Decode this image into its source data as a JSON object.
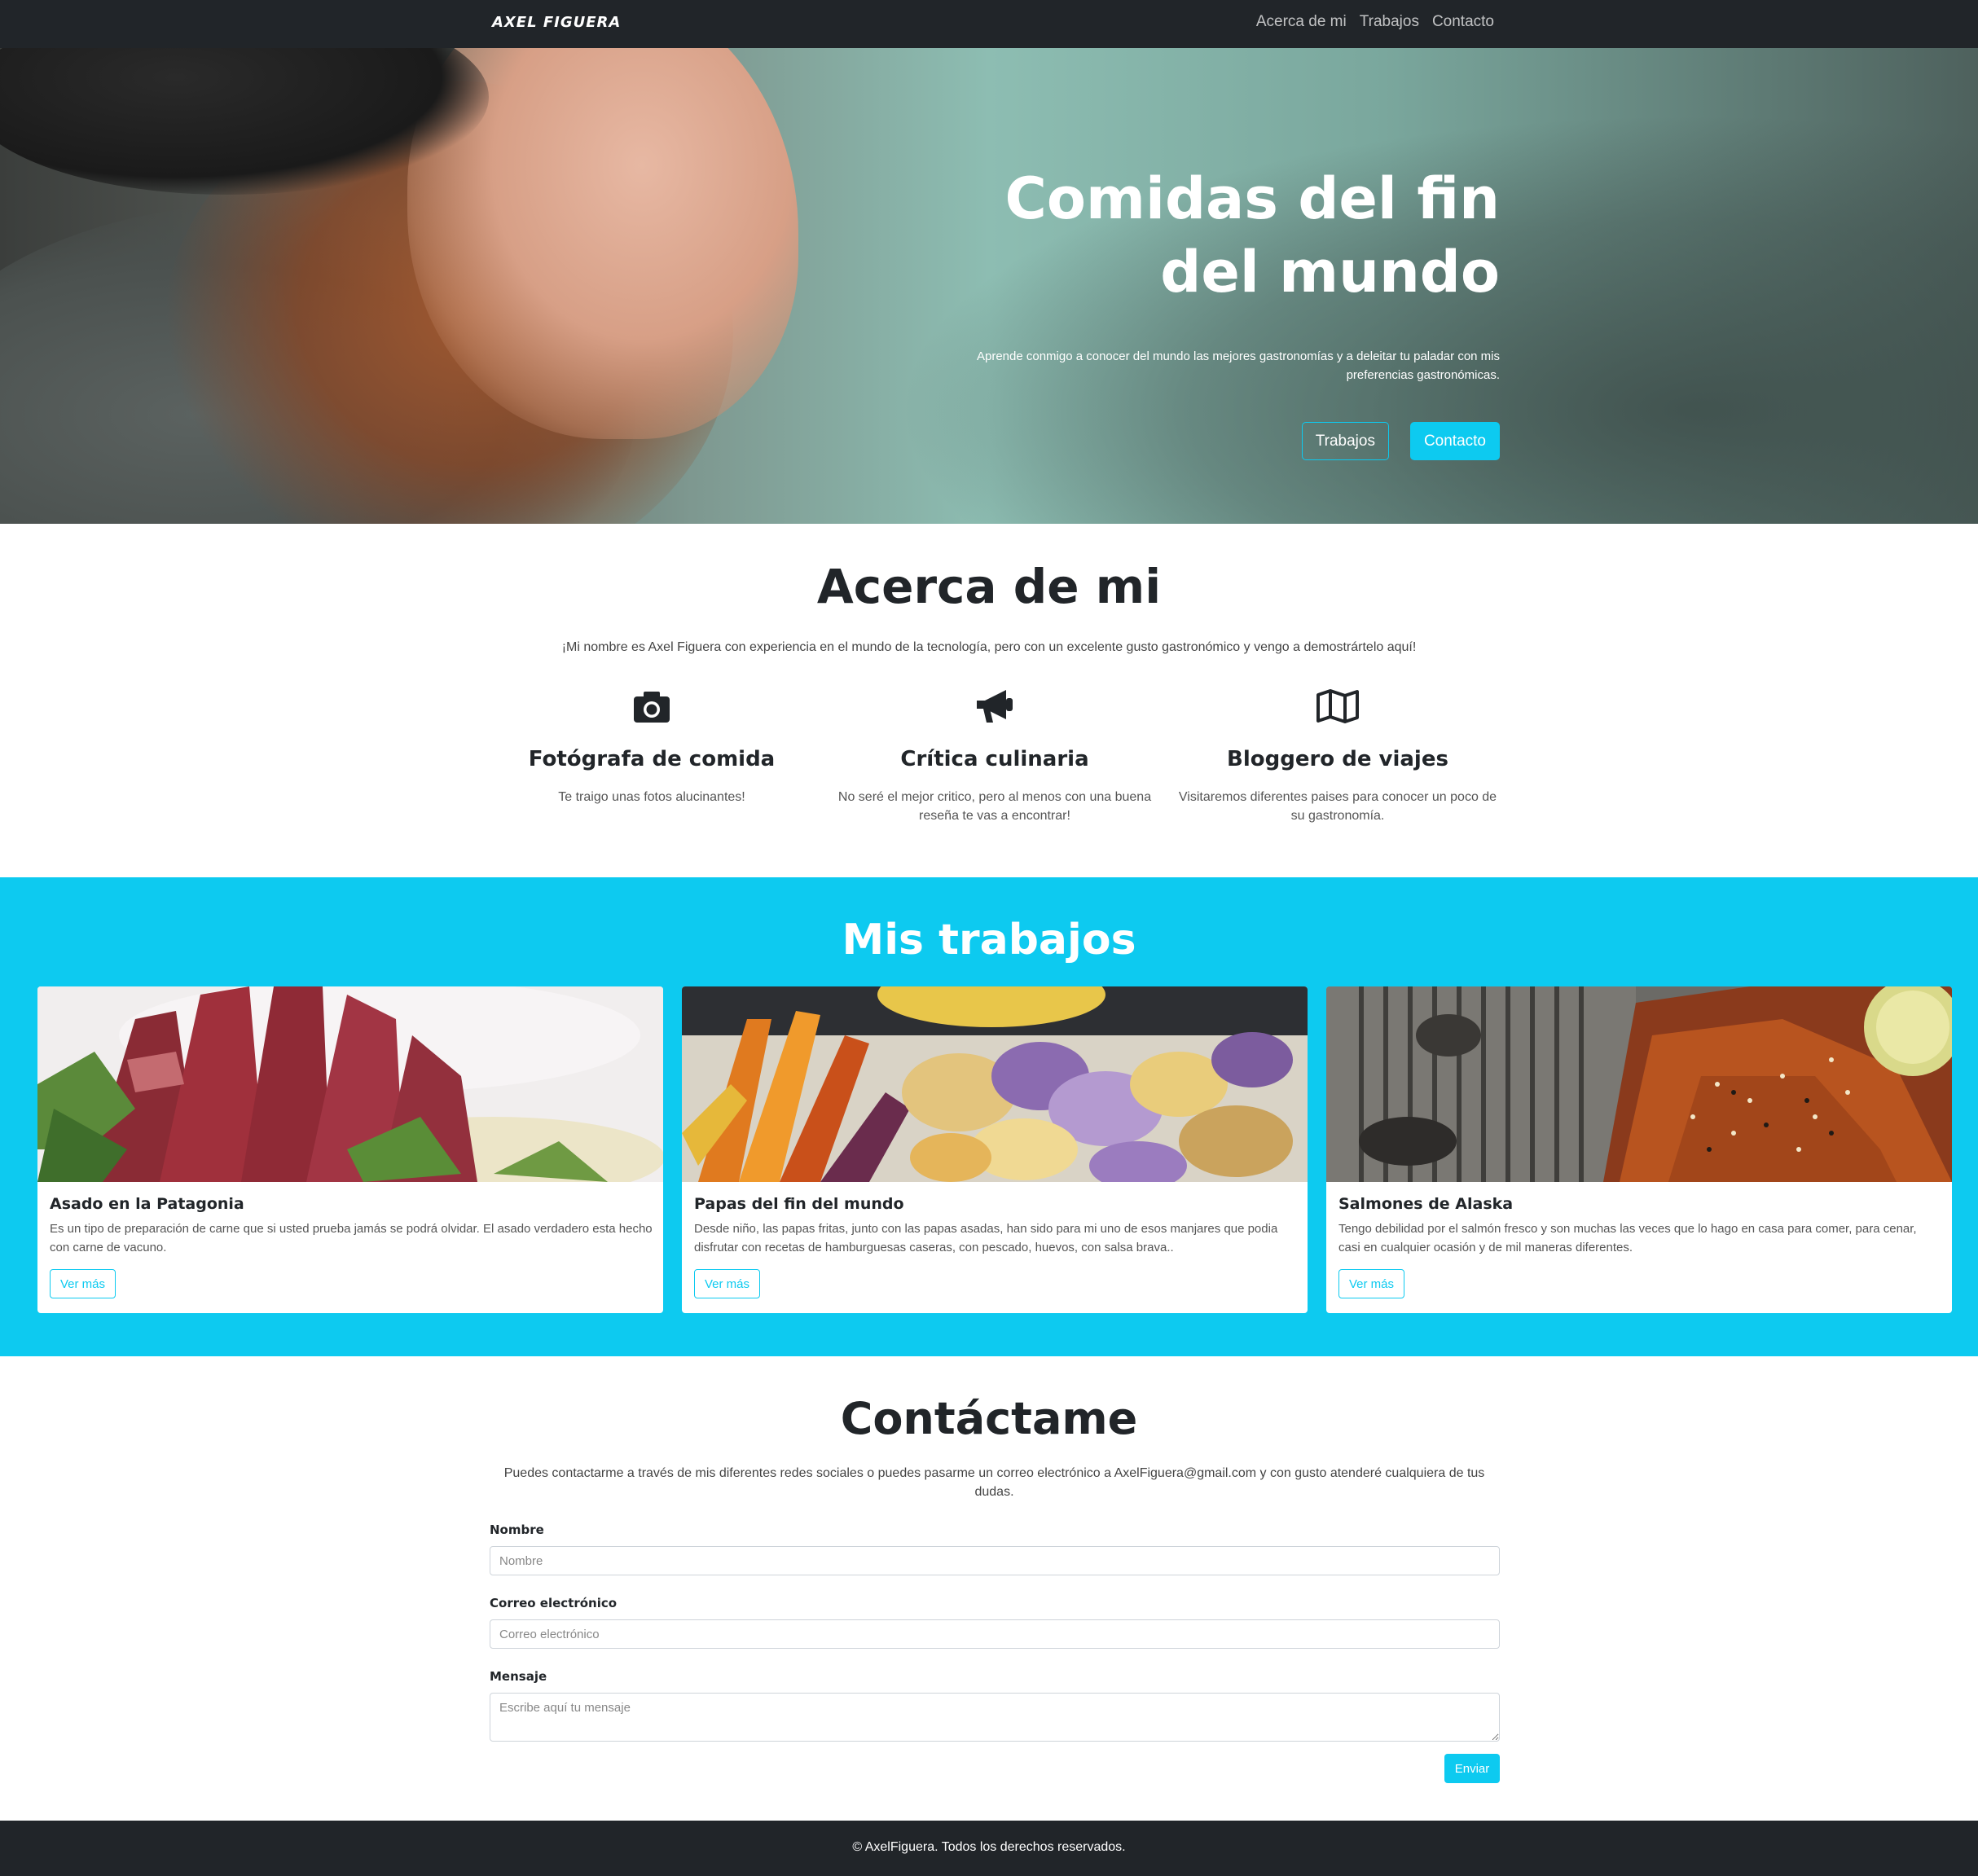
{
  "navbar": {
    "brand": "AXEL FIGUERA",
    "links": [
      "Acerca de mi",
      "Trabajos",
      "Contacto"
    ]
  },
  "hero": {
    "title": "Comidas del fin del mundo",
    "subtitle": "Aprende conmigo a conocer del mundo las mejores gastronomías y a deleitar tu paladar con mis preferencias gastronómicas.",
    "btn_works": "Trabajos",
    "btn_contact": "Contacto"
  },
  "about": {
    "title": "Acerca de mi",
    "text": "¡Mi nombre es Axel Figuera con experiencia en el mundo de la tecnología, pero con un excelente gusto gastronómico y vengo a demostrártelo aquí!",
    "features": [
      {
        "icon": "camera-icon",
        "title": "Fotógrafa de comida",
        "text": "Te traigo unas fotos alucinantes!"
      },
      {
        "icon": "megaphone-icon",
        "title": "Crítica culinaria",
        "text": "No seré el mejor critico, pero al menos con una buena reseña te vas a encontrar!"
      },
      {
        "icon": "map-icon",
        "title": "Bloggero de viajes",
        "text": "Visitaremos diferentes paises para conocer un poco de su gastronomía."
      }
    ]
  },
  "works": {
    "title": "Mis trabajos",
    "cards": [
      {
        "title": "Asado en la Patagonia",
        "text": "Es un tipo de preparación de carne que si usted prueba jamás se podrá olvidar. El asado verdadero esta hecho con carne de vacuno.",
        "button": "Ver más"
      },
      {
        "title": "Papas del fin del mundo",
        "text": "Desde niño, las papas fritas, junto con las papas asadas, han sido para mi uno de esos manjares que podia disfrutar con recetas de hamburguesas caseras, con pescado, huevos, con salsa brava..",
        "button": "Ver más"
      },
      {
        "title": "Salmones de Alaska",
        "text": "Tengo debilidad por el salmón fresco y son muchas las veces que lo hago en casa para comer, para cenar, casi en cualquier ocasión y de mil maneras diferentes.",
        "button": "Ver más"
      }
    ]
  },
  "contact": {
    "title": "Contáctame",
    "text": "Puedes contactarme a través de mis diferentes redes sociales o puedes pasarme un correo electrónico a AxelFiguera@gmail.com y con gusto atenderé cualquiera de tus dudas.",
    "name_label": "Nombre",
    "name_placeholder": "Nombre",
    "email_label": "Correo electrónico",
    "email_placeholder": "Correo electrónico",
    "message_label": "Mensaje",
    "message_placeholder": "Escribe aquí tu mensaje",
    "send": "Enviar"
  },
  "footer": {
    "text": "© AxelFiguera. Todos los derechos reservados."
  },
  "colors": {
    "dark": "#212529",
    "accent": "#0dcaf0"
  }
}
